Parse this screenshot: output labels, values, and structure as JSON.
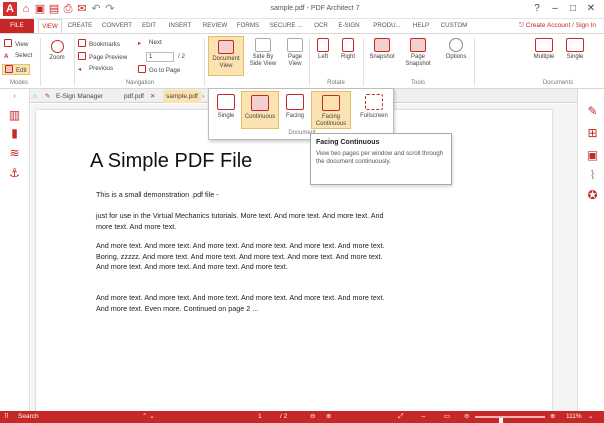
{
  "window": {
    "title": "sample.pdf  -  PDF Architect 7",
    "logo": "A"
  },
  "tabs": [
    {
      "label": "FILE"
    },
    {
      "label": "VIEW"
    },
    {
      "label": "CREATE"
    },
    {
      "label": "CONVERT"
    },
    {
      "label": "EDIT"
    },
    {
      "label": "INSERT"
    },
    {
      "label": "REVIEW"
    },
    {
      "label": "FORMS"
    },
    {
      "label": "SECURE ..."
    },
    {
      "label": "OCR"
    },
    {
      "label": "E-SIGN"
    },
    {
      "label": "PRODU..."
    },
    {
      "label": "HELP"
    },
    {
      "label": "CUSTOM"
    }
  ],
  "account": "⎋ Create Account / Sign In",
  "ribbon": {
    "modes": {
      "view": "View",
      "select": "Select",
      "edit": "Edit",
      "label": "Modes"
    },
    "zoom": "Zoom",
    "navigation": {
      "bookmarks": "Bookmarks",
      "page_preview": "Page Preview",
      "previous": "Previous",
      "next": "Next",
      "goto": "Go to Page",
      "page": "1",
      "total": "2",
      "label": "Navigation"
    },
    "document_view": {
      "label": "Document View",
      "side_by_side": "Side By Side View",
      "page_view": "Page View"
    },
    "rotate": {
      "left": "Left",
      "right": "Right",
      "label": "Rotate"
    },
    "tools": {
      "snapshot": "Snapshot",
      "page_snapshot": "Page Snapshot",
      "options": "Options",
      "label": "Tools"
    },
    "documents": {
      "multiple": "Multiple",
      "single": "Single",
      "label": "Documents"
    }
  },
  "doc_tabs": {
    "esign": "E-Sign Manager",
    "pdf": "pdf.pdf",
    "sample": "sample.pdf"
  },
  "dropdown": {
    "items": [
      {
        "label": "Single"
      },
      {
        "label": "Continuous"
      },
      {
        "label": "Facing"
      },
      {
        "label": "Facing Continuous"
      },
      {
        "label": "Fullscreen"
      }
    ],
    "group_label": "Document"
  },
  "tooltip": {
    "title": "Facing Continuous",
    "text": "View two pages per window and scroll through the document continuously."
  },
  "pdf": {
    "title": "A Simple PDF File",
    "paragraphs": [
      "This is a small demonstration .pdf file -",
      "just for use in the Virtual Mechanics tutorials. More text. And more text. And more text. And more text. And more text.",
      "And more text. And more text. And more text. And more text. And more text. And more text. Boring, zzzzz. And more text. And more text. And more text. And more text. And more text. And more text. And more text. And more text. And more text.",
      "And more text. And more text. And more text. And more text. And more text. And more text. And more text. Even more. Continued on page 2 ..."
    ]
  },
  "status": {
    "search": "Search",
    "page": "1",
    "total": "/ 2",
    "zoom": "111%",
    "zoom_level": 0.37
  },
  "colors": {
    "accent": "#c62828",
    "highlight": "#fbe3b1"
  }
}
